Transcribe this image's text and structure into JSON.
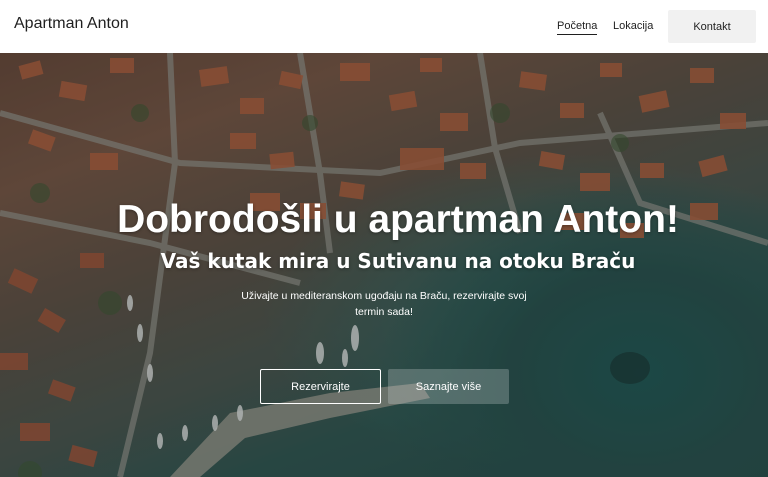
{
  "header": {
    "brand": "Apartman Anton",
    "nav": {
      "home": "Početna",
      "location": "Lokacija",
      "contact": "Kontakt"
    }
  },
  "hero": {
    "title": "Dobrodošli u apartman Anton!",
    "subtitle": "Vaš kutak mira u Sutivanu na otoku Braču",
    "description": "Uživajte u mediteranskom ugođaju na Braču, rezervirajte svoj termin sada!",
    "buttons": {
      "reserve": "Rezervirajte",
      "more": "Saznajte više"
    }
  },
  "colors": {
    "header_bg": "#ffffff",
    "text_dark": "#1f1f1f",
    "contact_bg": "#f1f1f1",
    "hero_text": "#ffffff",
    "sea": "#27534f",
    "roof": "#b5623f"
  }
}
